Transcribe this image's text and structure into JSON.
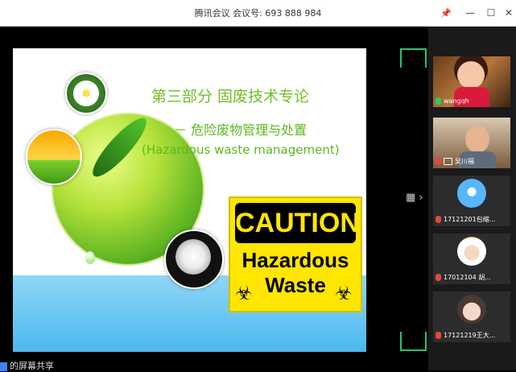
{
  "window": {
    "title": "腾讯会议 会议号: 693 888 984",
    "controls": [
      "pin-icon",
      "minimize-icon",
      "maximize-icon",
      "close-icon"
    ]
  },
  "slide": {
    "title": "第三部分 固废技术专论",
    "subtitle_cn": "－ 危险废物管理与处置",
    "subtitle_en": "(Hazardous waste management)",
    "sign": {
      "header": "CAUTION",
      "line1": "Hazardous",
      "line2": "Waste"
    }
  },
  "screen_share_label": "的屏幕共享",
  "participants": [
    {
      "name": "wangqh",
      "mic": "on"
    },
    {
      "name": "吴川福",
      "mic": "muted"
    },
    {
      "name": "17121201包缩...",
      "mic": "muted"
    },
    {
      "name": "17012104 胡...",
      "mic": "muted"
    },
    {
      "name": "17121219王大...",
      "mic": "muted"
    }
  ],
  "colors": {
    "accent_green": "#1ec96a",
    "title_green": "#6fbf2a",
    "caution_yellow": "#ffe600"
  }
}
